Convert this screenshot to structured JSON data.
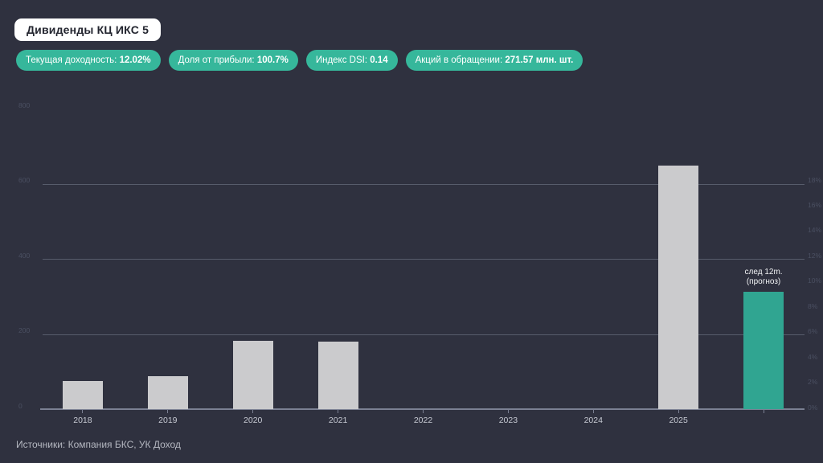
{
  "header": {
    "title": "Дивиденды КЦ ИКС 5"
  },
  "stats": {
    "badges": [
      {
        "label": "Текущая доходность:",
        "value": "12.02%"
      },
      {
        "label": "Доля от прибыли:",
        "value": "100.7%"
      },
      {
        "label": "Индекс DSI:",
        "value": "0.14"
      },
      {
        "label": "Акций в обращении:",
        "value": "271.57 млн. шт."
      }
    ]
  },
  "chart_data": {
    "type": "bar",
    "title": "Дивиденды КЦ ИКС 5",
    "categories": [
      "2018",
      "2019",
      "2020",
      "2021",
      "2022",
      "2023",
      "2024",
      "2025",
      "след 12m. (прогноз)"
    ],
    "values": [
      75,
      88,
      182,
      180,
      0,
      0,
      0,
      648,
      312
    ],
    "forecast_index": 8,
    "forecast_annotation_lines": [
      "след 12m.",
      "(прогноз)"
    ],
    "left_axis": {
      "ticks": [
        0,
        200,
        400,
        600,
        800
      ],
      "range": [
        0,
        810
      ]
    },
    "right_axis": {
      "ticks": [
        "0%",
        "2%",
        "4%",
        "6%",
        "8%",
        "10%",
        "12%",
        "14%",
        "16%",
        "18%"
      ],
      "range_percent": [
        0,
        18
      ]
    },
    "gridline_values": [
      200,
      400,
      600
    ],
    "legend": "none",
    "bar_colors": {
      "historical": "#cbcbcd",
      "forecast": "#30a591"
    }
  },
  "footer": {
    "source": "Источники: Компания БКС, УК Доход"
  },
  "colors": {
    "background": "#2f313f",
    "badge": "#36b79b",
    "grid": "#575c6b",
    "axis": "#7b8093",
    "axis_label_dim": "#4b5062",
    "category_label": "#c6c9d2",
    "annotation": "#f2f3f5",
    "source_text": "#b4b7c0",
    "title_bg": "#ffffff",
    "title_text": "#23252f"
  }
}
